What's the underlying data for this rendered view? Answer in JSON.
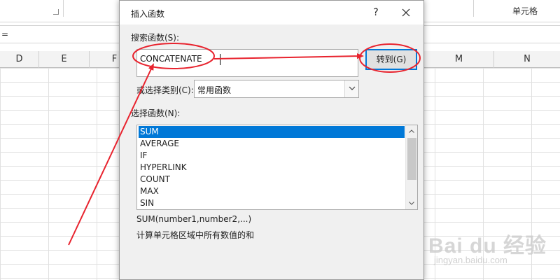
{
  "ribbon": {
    "group_label": "单元格"
  },
  "formula_bar": {
    "text": "="
  },
  "columns": [
    "D",
    "E",
    "F",
    "",
    "",
    "",
    "",
    "",
    "",
    "M",
    "N"
  ],
  "dialog": {
    "title": "插入函数",
    "help": "?",
    "search_label": "搜索函数(S):",
    "search_value": "CONCATENATE",
    "goto_label": "转到(G)",
    "category_label": "或选择类别(C):",
    "category_value": "常用函数",
    "select_label": "选择函数(N):",
    "functions": [
      "SUM",
      "AVERAGE",
      "IF",
      "HYPERLINK",
      "COUNT",
      "MAX",
      "SIN"
    ],
    "selected_function": "SUM",
    "syntax": "SUM(number1,number2,...)",
    "description": "计算单元格区域中所有数值的和"
  },
  "watermark": {
    "brand": "Bai du 经验",
    "url": "jingyan.baidu.com"
  },
  "colors": {
    "accent": "#0078d7",
    "annotation": "#e8232e"
  }
}
